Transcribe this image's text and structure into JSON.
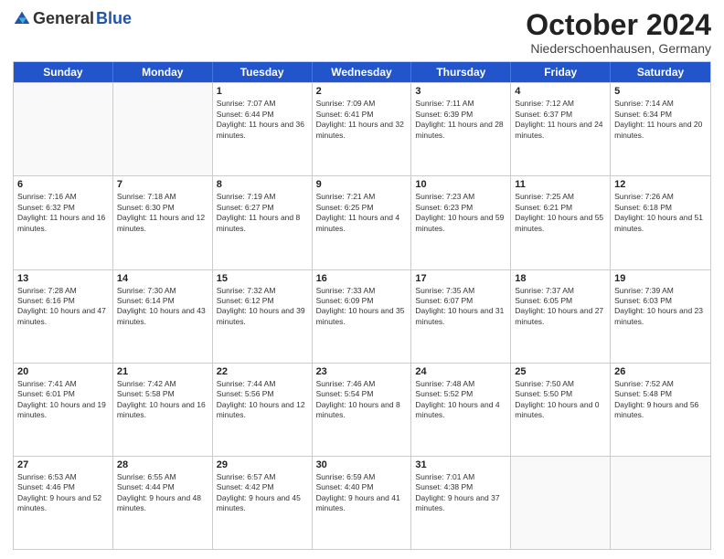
{
  "logo": {
    "general": "General",
    "blue": "Blue"
  },
  "title": "October 2024",
  "subtitle": "Niederschoenhausen, Germany",
  "header_days": [
    "Sunday",
    "Monday",
    "Tuesday",
    "Wednesday",
    "Thursday",
    "Friday",
    "Saturday"
  ],
  "weeks": [
    [
      {
        "day": "",
        "sunrise": "",
        "sunset": "",
        "daylight": "",
        "empty": true
      },
      {
        "day": "",
        "sunrise": "",
        "sunset": "",
        "daylight": "",
        "empty": true
      },
      {
        "day": "1",
        "sunrise": "Sunrise: 7:07 AM",
        "sunset": "Sunset: 6:44 PM",
        "daylight": "Daylight: 11 hours and 36 minutes."
      },
      {
        "day": "2",
        "sunrise": "Sunrise: 7:09 AM",
        "sunset": "Sunset: 6:41 PM",
        "daylight": "Daylight: 11 hours and 32 minutes."
      },
      {
        "day": "3",
        "sunrise": "Sunrise: 7:11 AM",
        "sunset": "Sunset: 6:39 PM",
        "daylight": "Daylight: 11 hours and 28 minutes."
      },
      {
        "day": "4",
        "sunrise": "Sunrise: 7:12 AM",
        "sunset": "Sunset: 6:37 PM",
        "daylight": "Daylight: 11 hours and 24 minutes."
      },
      {
        "day": "5",
        "sunrise": "Sunrise: 7:14 AM",
        "sunset": "Sunset: 6:34 PM",
        "daylight": "Daylight: 11 hours and 20 minutes."
      }
    ],
    [
      {
        "day": "6",
        "sunrise": "Sunrise: 7:16 AM",
        "sunset": "Sunset: 6:32 PM",
        "daylight": "Daylight: 11 hours and 16 minutes."
      },
      {
        "day": "7",
        "sunrise": "Sunrise: 7:18 AM",
        "sunset": "Sunset: 6:30 PM",
        "daylight": "Daylight: 11 hours and 12 minutes."
      },
      {
        "day": "8",
        "sunrise": "Sunrise: 7:19 AM",
        "sunset": "Sunset: 6:27 PM",
        "daylight": "Daylight: 11 hours and 8 minutes."
      },
      {
        "day": "9",
        "sunrise": "Sunrise: 7:21 AM",
        "sunset": "Sunset: 6:25 PM",
        "daylight": "Daylight: 11 hours and 4 minutes."
      },
      {
        "day": "10",
        "sunrise": "Sunrise: 7:23 AM",
        "sunset": "Sunset: 6:23 PM",
        "daylight": "Daylight: 10 hours and 59 minutes."
      },
      {
        "day": "11",
        "sunrise": "Sunrise: 7:25 AM",
        "sunset": "Sunset: 6:21 PM",
        "daylight": "Daylight: 10 hours and 55 minutes."
      },
      {
        "day": "12",
        "sunrise": "Sunrise: 7:26 AM",
        "sunset": "Sunset: 6:18 PM",
        "daylight": "Daylight: 10 hours and 51 minutes."
      }
    ],
    [
      {
        "day": "13",
        "sunrise": "Sunrise: 7:28 AM",
        "sunset": "Sunset: 6:16 PM",
        "daylight": "Daylight: 10 hours and 47 minutes."
      },
      {
        "day": "14",
        "sunrise": "Sunrise: 7:30 AM",
        "sunset": "Sunset: 6:14 PM",
        "daylight": "Daylight: 10 hours and 43 minutes."
      },
      {
        "day": "15",
        "sunrise": "Sunrise: 7:32 AM",
        "sunset": "Sunset: 6:12 PM",
        "daylight": "Daylight: 10 hours and 39 minutes."
      },
      {
        "day": "16",
        "sunrise": "Sunrise: 7:33 AM",
        "sunset": "Sunset: 6:09 PM",
        "daylight": "Daylight: 10 hours and 35 minutes."
      },
      {
        "day": "17",
        "sunrise": "Sunrise: 7:35 AM",
        "sunset": "Sunset: 6:07 PM",
        "daylight": "Daylight: 10 hours and 31 minutes."
      },
      {
        "day": "18",
        "sunrise": "Sunrise: 7:37 AM",
        "sunset": "Sunset: 6:05 PM",
        "daylight": "Daylight: 10 hours and 27 minutes."
      },
      {
        "day": "19",
        "sunrise": "Sunrise: 7:39 AM",
        "sunset": "Sunset: 6:03 PM",
        "daylight": "Daylight: 10 hours and 23 minutes."
      }
    ],
    [
      {
        "day": "20",
        "sunrise": "Sunrise: 7:41 AM",
        "sunset": "Sunset: 6:01 PM",
        "daylight": "Daylight: 10 hours and 19 minutes."
      },
      {
        "day": "21",
        "sunrise": "Sunrise: 7:42 AM",
        "sunset": "Sunset: 5:58 PM",
        "daylight": "Daylight: 10 hours and 16 minutes."
      },
      {
        "day": "22",
        "sunrise": "Sunrise: 7:44 AM",
        "sunset": "Sunset: 5:56 PM",
        "daylight": "Daylight: 10 hours and 12 minutes."
      },
      {
        "day": "23",
        "sunrise": "Sunrise: 7:46 AM",
        "sunset": "Sunset: 5:54 PM",
        "daylight": "Daylight: 10 hours and 8 minutes."
      },
      {
        "day": "24",
        "sunrise": "Sunrise: 7:48 AM",
        "sunset": "Sunset: 5:52 PM",
        "daylight": "Daylight: 10 hours and 4 minutes."
      },
      {
        "day": "25",
        "sunrise": "Sunrise: 7:50 AM",
        "sunset": "Sunset: 5:50 PM",
        "daylight": "Daylight: 10 hours and 0 minutes."
      },
      {
        "day": "26",
        "sunrise": "Sunrise: 7:52 AM",
        "sunset": "Sunset: 5:48 PM",
        "daylight": "Daylight: 9 hours and 56 minutes."
      }
    ],
    [
      {
        "day": "27",
        "sunrise": "Sunrise: 6:53 AM",
        "sunset": "Sunset: 4:46 PM",
        "daylight": "Daylight: 9 hours and 52 minutes."
      },
      {
        "day": "28",
        "sunrise": "Sunrise: 6:55 AM",
        "sunset": "Sunset: 4:44 PM",
        "daylight": "Daylight: 9 hours and 48 minutes."
      },
      {
        "day": "29",
        "sunrise": "Sunrise: 6:57 AM",
        "sunset": "Sunset: 4:42 PM",
        "daylight": "Daylight: 9 hours and 45 minutes."
      },
      {
        "day": "30",
        "sunrise": "Sunrise: 6:59 AM",
        "sunset": "Sunset: 4:40 PM",
        "daylight": "Daylight: 9 hours and 41 minutes."
      },
      {
        "day": "31",
        "sunrise": "Sunrise: 7:01 AM",
        "sunset": "Sunset: 4:38 PM",
        "daylight": "Daylight: 9 hours and 37 minutes."
      },
      {
        "day": "",
        "sunrise": "",
        "sunset": "",
        "daylight": "",
        "empty": true
      },
      {
        "day": "",
        "sunrise": "",
        "sunset": "",
        "daylight": "",
        "empty": true
      }
    ]
  ]
}
